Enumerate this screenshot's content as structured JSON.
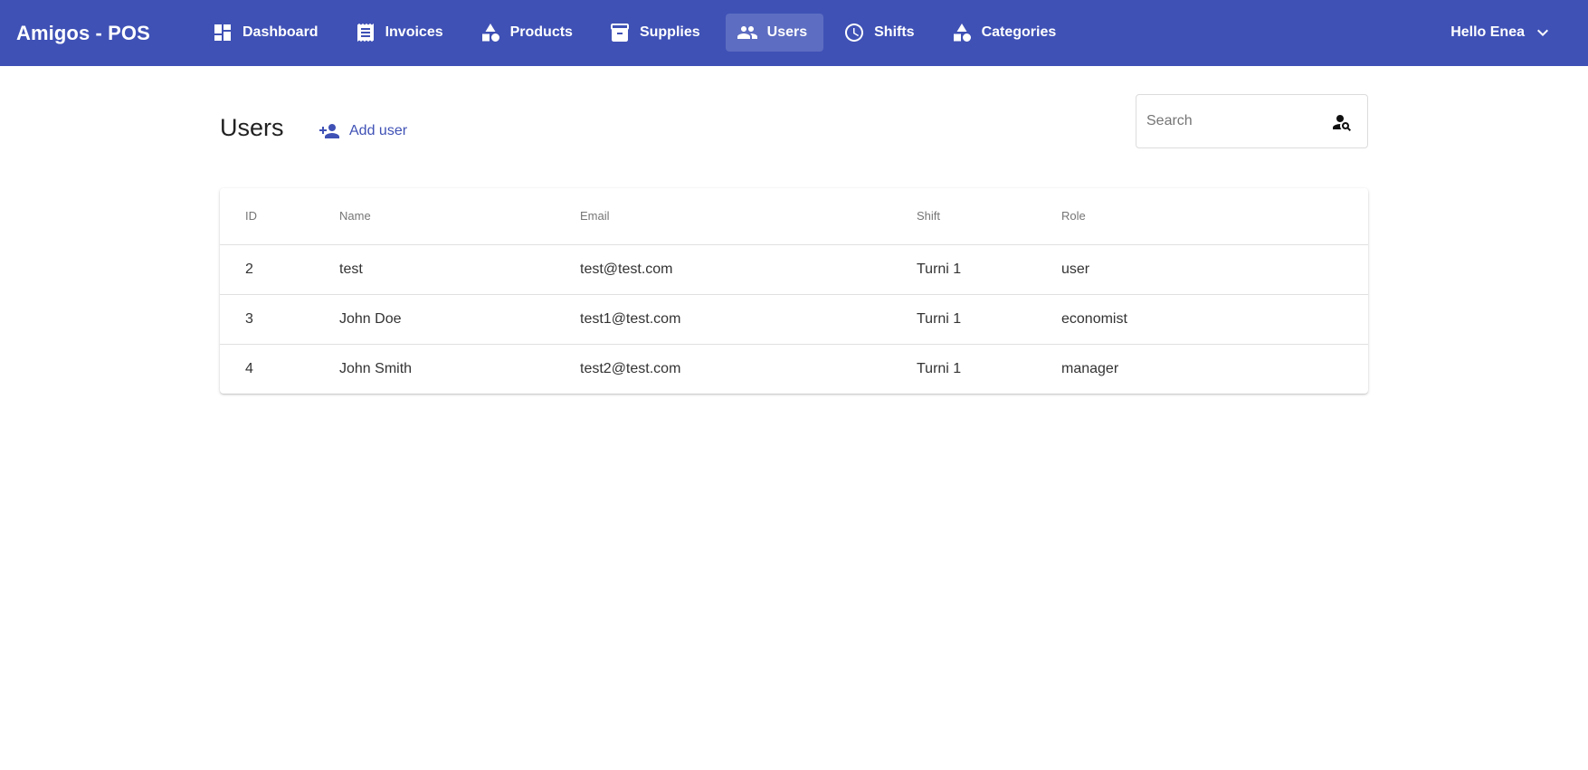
{
  "app": {
    "title": "Amigos - POS"
  },
  "nav": {
    "items": [
      {
        "label": "Dashboard",
        "icon": "dashboard-icon",
        "active": false
      },
      {
        "label": "Invoices",
        "icon": "receipt-icon",
        "active": false
      },
      {
        "label": "Products",
        "icon": "category-shapes-icon",
        "active": false
      },
      {
        "label": "Supplies",
        "icon": "archive-box-icon",
        "active": false
      },
      {
        "label": "Users",
        "icon": "people-icon",
        "active": true
      },
      {
        "label": "Shifts",
        "icon": "clock-icon",
        "active": false
      },
      {
        "label": "Categories",
        "icon": "category-shapes-icon",
        "active": false
      }
    ]
  },
  "user_menu": {
    "greeting": "Hello Enea",
    "icon": "chevron-down-icon"
  },
  "page": {
    "title": "Users",
    "add_button": "Add user",
    "add_icon": "person-add-icon"
  },
  "search": {
    "placeholder": "Search",
    "value": "",
    "icon": "person-search-icon"
  },
  "table": {
    "columns": [
      "ID",
      "Name",
      "Email",
      "Shift",
      "Role"
    ],
    "rows": [
      {
        "id": "2",
        "name": "test",
        "email": "test@test.com",
        "shift": "Turni 1",
        "role": "user"
      },
      {
        "id": "3",
        "name": "John Doe",
        "email": "test1@test.com",
        "shift": "Turni 1",
        "role": "economist"
      },
      {
        "id": "4",
        "name": "John Smith",
        "email": "test2@test.com",
        "shift": "Turni 1",
        "role": "manager"
      }
    ]
  },
  "colors": {
    "primary": "#3f51b5",
    "header_text": "#ffffff"
  }
}
